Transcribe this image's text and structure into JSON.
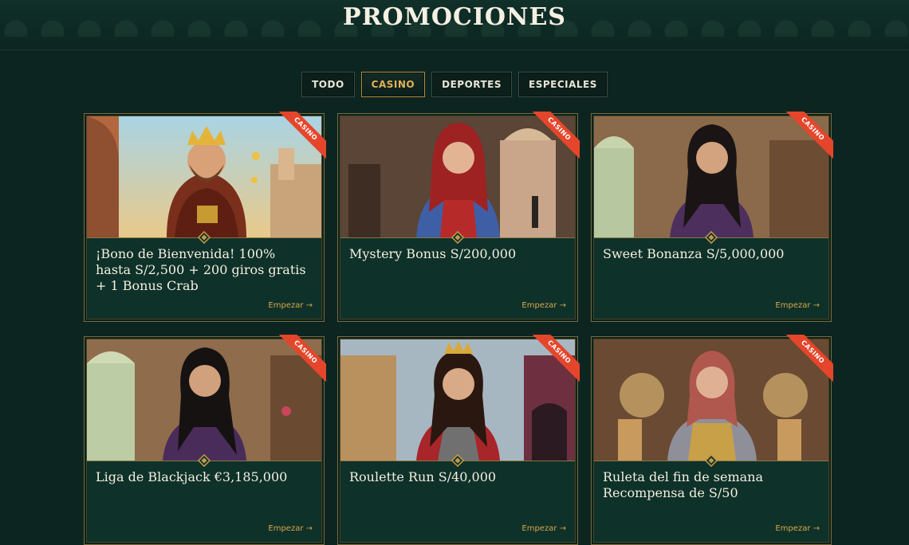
{
  "page": {
    "title": "PROMOCIONES"
  },
  "tabs": [
    {
      "label": "TODO",
      "active": false
    },
    {
      "label": "CASINO",
      "active": true
    },
    {
      "label": "DEPORTES",
      "active": false
    },
    {
      "label": "ESPECIALES",
      "active": false
    }
  ],
  "colors": {
    "accent": "#d9a64a",
    "ribbon": "#e5462b",
    "background": "#0d2520",
    "card": "#0e3129"
  },
  "promotions": [
    {
      "ribbon": "CASINO",
      "title": "¡Bono de Bienvenida! 100% hasta S/2,500 + 200 giros gratis + 1 Bonus Crab",
      "link": "Empezar →",
      "image": "king-illustration"
    },
    {
      "ribbon": "CASINO",
      "title": "Mystery Bonus S/200,000",
      "link": "Empezar →",
      "image": "red-haired-knight-illustration"
    },
    {
      "ribbon": "CASINO",
      "title": "Sweet Bonanza S/5,000,000",
      "link": "Empezar →",
      "image": "dark-haired-lady-illustration"
    },
    {
      "ribbon": "CASINO",
      "title": "Liga de Blackjack €3,185,000",
      "link": "Empezar →",
      "image": "dark-haired-lady-illustration"
    },
    {
      "ribbon": "CASINO",
      "title": "Roulette Run S/40,000",
      "link": "Empezar →",
      "image": "queen-illustration"
    },
    {
      "ribbon": "CASINO",
      "title": "Ruleta del fin de semana Recompensa de S/50",
      "link": "Empezar →",
      "image": "armored-lady-illustration"
    }
  ]
}
